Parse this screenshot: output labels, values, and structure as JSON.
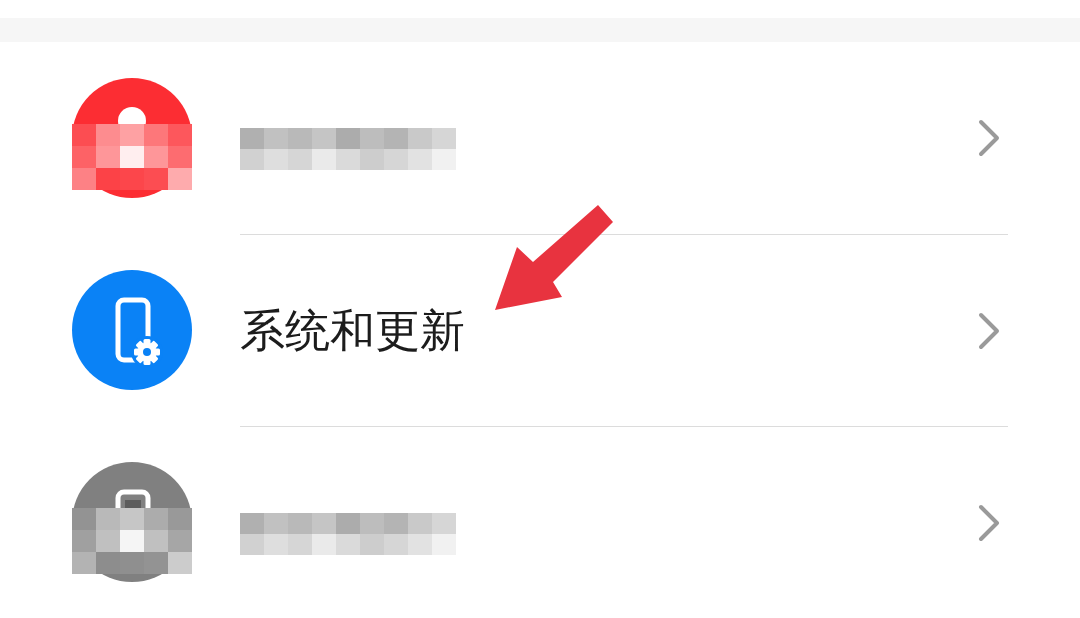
{
  "settings_list": {
    "rows": [
      {
        "kind": "user",
        "color": "#fc2d33",
        "redacted": true,
        "arrow": false
      },
      {
        "kind": "system",
        "color": "#0a82f6",
        "label": "系统和更新",
        "redacted": false,
        "arrow": true
      },
      {
        "kind": "device",
        "color": "#808080",
        "redacted": true,
        "arrow": false
      }
    ]
  }
}
